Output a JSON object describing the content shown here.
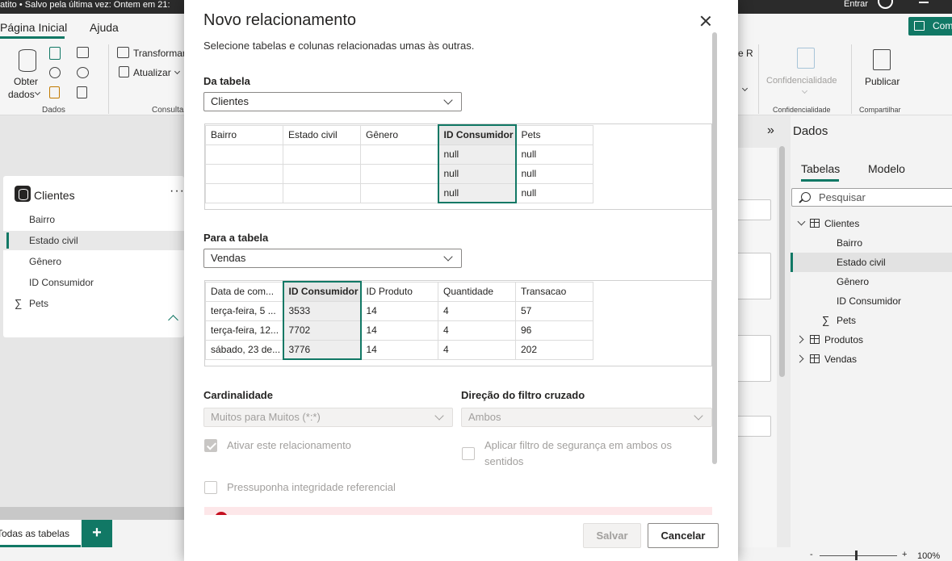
{
  "titlebar": {
    "text": "atito • Salvo pela última vez: Ontem em 21:",
    "signin": "Entrar"
  },
  "ribbon": {
    "tabs": [
      "Página Inicial",
      "Ajuda"
    ],
    "get_data": "Obter",
    "get_data2": "dados",
    "group_data": "Dados",
    "transform": "Transformar",
    "refresh": "Atualizar",
    "group_queries": "Consultas",
    "r_label": "e R",
    "sensitivity": "Confidencialidade",
    "group_sensitivity": "Confidencialidade",
    "publish": "Publicar",
    "group_share": "Compartilhar",
    "share": "Com"
  },
  "canvas_card": {
    "title": "Clientes",
    "more": "···",
    "fields": [
      "Bairro",
      "Estado civil",
      "Gênero",
      "ID Consumidor",
      "Pets"
    ],
    "selected_field": "Estado civil",
    "sigma": "∑"
  },
  "bottom": {
    "page_tab": "Todas as tabelas",
    "add": "+"
  },
  "data_pane": {
    "title": "Dados",
    "collapse": "»",
    "tabs": [
      "Tabelas",
      "Modelo"
    ],
    "search_placeholder": "Pesquisar",
    "tables": [
      {
        "name": "Clientes",
        "expanded": true
      },
      {
        "name": "Produtos",
        "expanded": false
      },
      {
        "name": "Vendas",
        "expanded": false
      }
    ],
    "clientes_fields": [
      "Bairro",
      "Estado civil",
      "Gênero",
      "ID Consumidor",
      "Pets"
    ],
    "selected_field": "Estado civil",
    "sigma": "∑"
  },
  "statusbar": {
    "minus": "-",
    "plus": "+",
    "zoom": "100%"
  },
  "dialog": {
    "title": "Novo relacionamento",
    "subtitle": "Selecione tabelas e colunas relacionadas umas às outras.",
    "from_label": "Da tabela",
    "from_table": "Clientes",
    "from_columns": [
      "Bairro",
      "Estado civil",
      "Gênero",
      "ID Consumidor",
      "Pets"
    ],
    "from_rows": [
      [
        "",
        "",
        "",
        "null",
        "null"
      ],
      [
        "",
        "",
        "",
        "null",
        "null"
      ],
      [
        "",
        "",
        "",
        "null",
        "null"
      ]
    ],
    "to_label": "Para a tabela",
    "to_table": "Vendas",
    "to_columns": [
      "Data de com...",
      "ID Consumidor",
      "ID Produto",
      "Quantidade",
      "Transacao"
    ],
    "to_rows": [
      [
        "terça-feira, 5 ...",
        "3533",
        "14",
        "4",
        "57"
      ],
      [
        "terça-feira, 12...",
        "7702",
        "14",
        "4",
        "96"
      ],
      [
        "sábado, 23 de...",
        "3776",
        "14",
        "4",
        "202"
      ]
    ],
    "cardinality_label": "Cardinalidade",
    "cardinality_value": "Muitos para Muitos (*:*)",
    "crossfilter_label": "Direção do filtro cruzado",
    "crossfilter_value": "Ambos",
    "activate_label": "Ativar este relacionamento",
    "security_label_1": "Aplicar filtro de segurança em ambos os",
    "security_label_2": "sentidos",
    "integrity_label": "Pressuponha integridade referencial",
    "save": "Salvar",
    "cancel": "Cancelar"
  }
}
